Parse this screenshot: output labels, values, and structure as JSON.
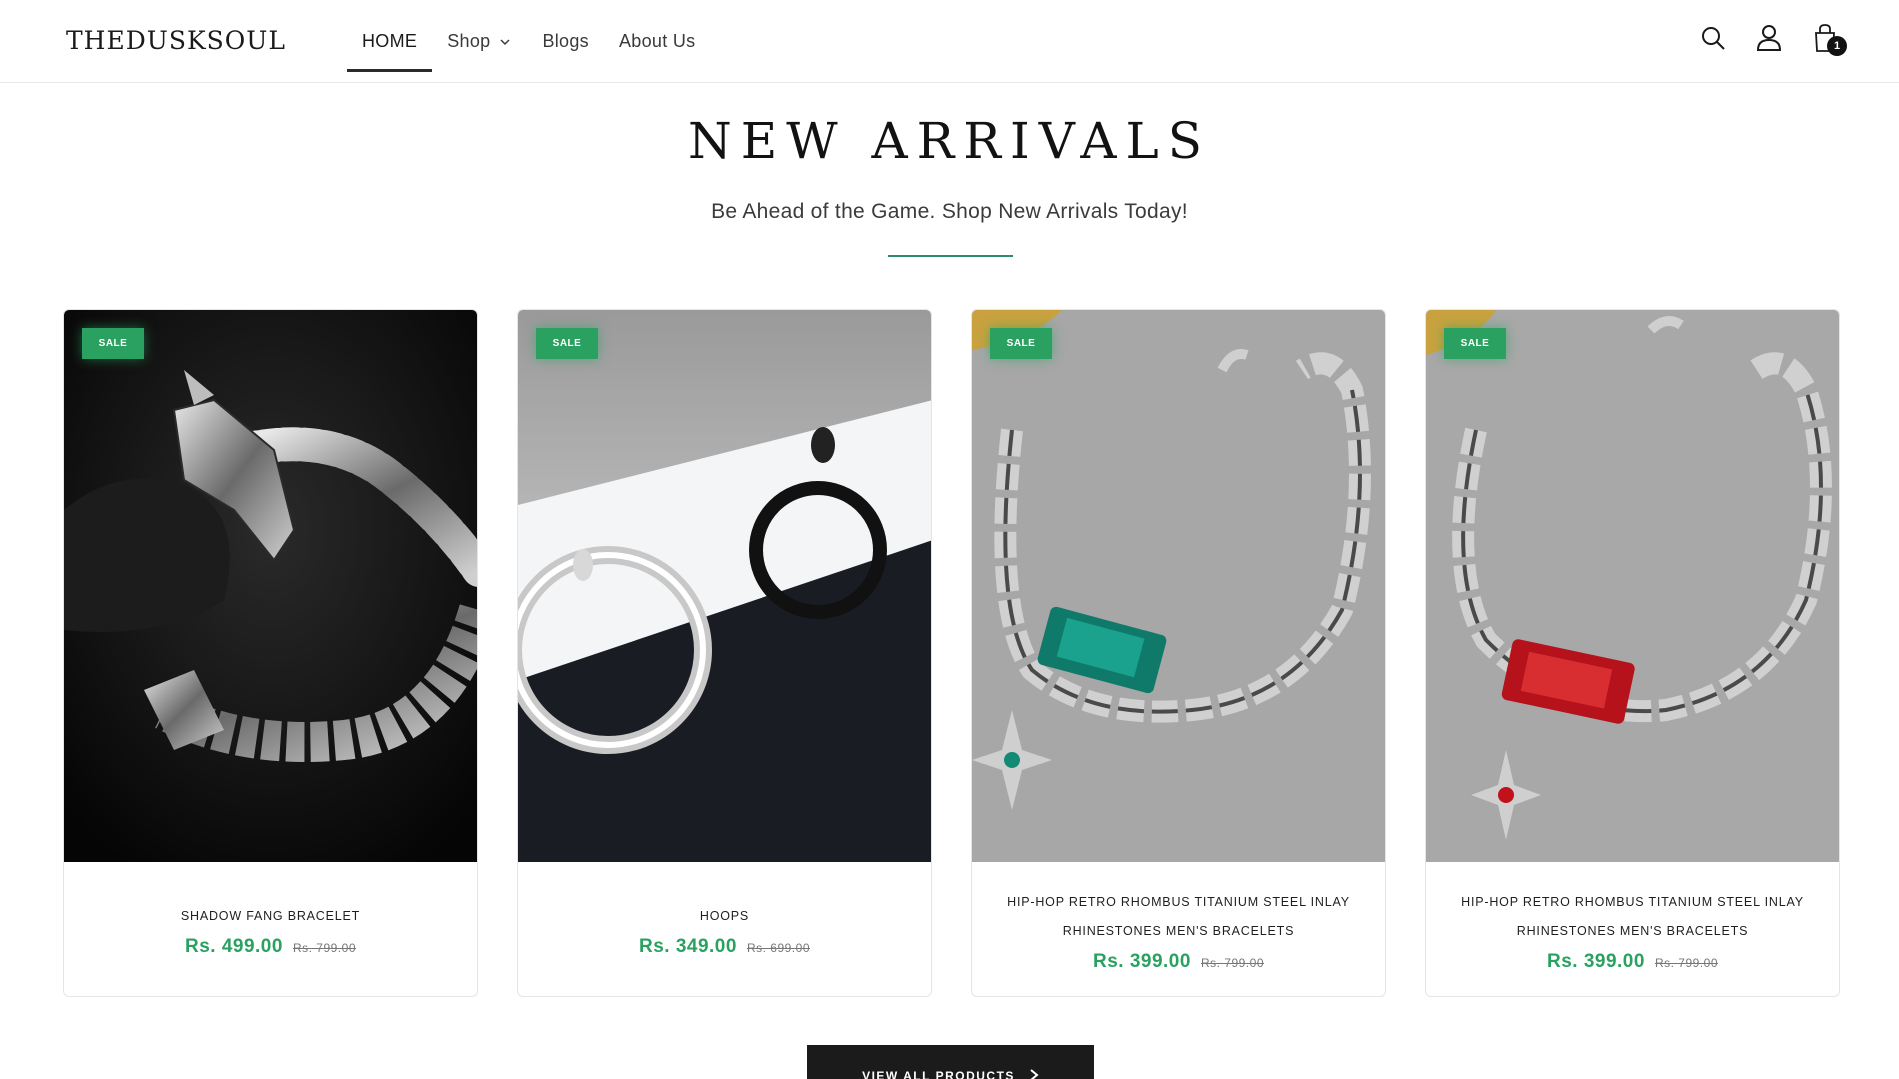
{
  "header": {
    "logo": "THEDUSKSOUL",
    "nav": [
      {
        "label": "HOME",
        "active": true
      },
      {
        "label": "Shop",
        "has_dropdown": true
      },
      {
        "label": "Blogs"
      },
      {
        "label": "About Us"
      }
    ],
    "icons": [
      "search-icon",
      "account-icon",
      "cart-icon"
    ],
    "cart_count": "1"
  },
  "section": {
    "title": "NEW ARRIVALS",
    "subtitle": "Be Ahead of the Game. Shop New Arrivals Today!"
  },
  "products": [
    {
      "badge": "SALE",
      "name": "SHADOW FANG BRACELET",
      "price": "Rs. 499.00",
      "compare_price": "Rs. 799.00"
    },
    {
      "badge": "SALE",
      "name": "HOOPS",
      "price": "Rs. 349.00",
      "compare_price": "Rs. 699.00"
    },
    {
      "badge": "SALE",
      "name": "HIP-HOP RETRO RHOMBUS TITANIUM STEEL INLAY RHINESTONES MEN'S BRACELETS",
      "price": "Rs. 399.00",
      "compare_price": "Rs. 799.00"
    },
    {
      "badge": "SALE",
      "name": "HIP-HOP RETRO RHOMBUS TITANIUM STEEL INLAY RHINESTONES MEN'S BRACELETS",
      "price": "Rs. 399.00",
      "compare_price": "Rs. 799.00"
    }
  ],
  "view_all": {
    "label": "VIEW ALL PRODUCTS"
  },
  "colors": {
    "accent": "#2aa160",
    "divider": "#2b8a6e",
    "button": "#1b1b1b"
  }
}
